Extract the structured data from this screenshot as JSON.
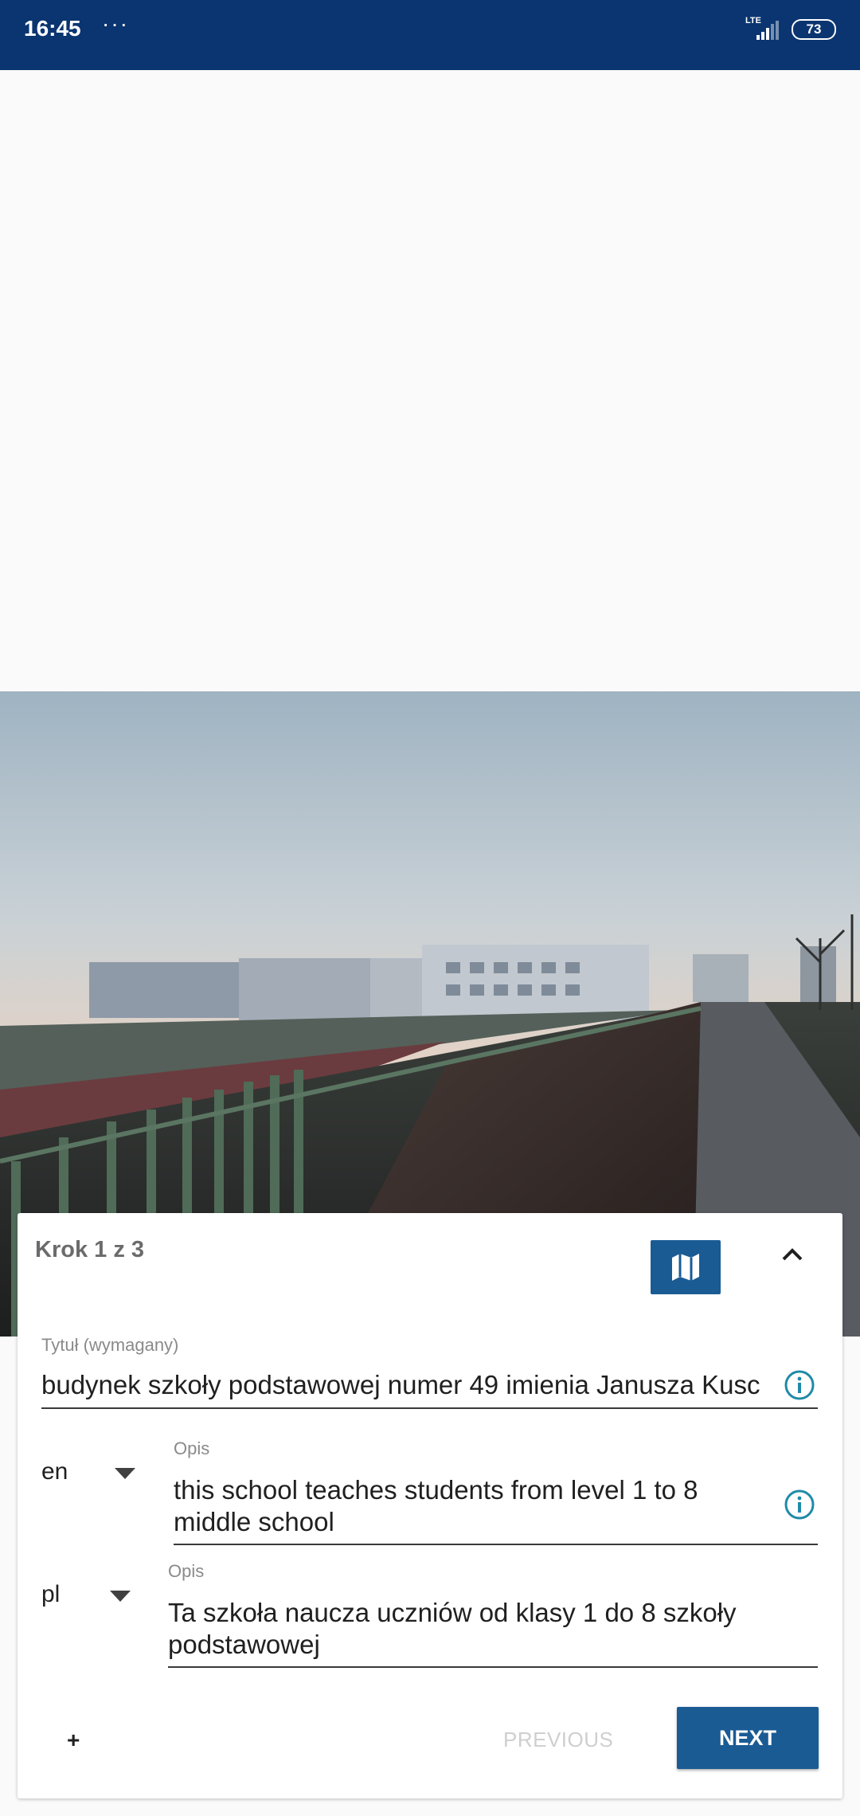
{
  "status_bar": {
    "time": "16:45",
    "overflow": "···",
    "network": "LTE",
    "battery": "73"
  },
  "wizard": {
    "step_label": "Krok 1 z 3",
    "title_field": {
      "label": "Tytuł (wymagany)",
      "value": "budynek szkoły podstawowej numer 49 imienia Janusza Kusc"
    },
    "descriptions": [
      {
        "language": "en",
        "label": "Opis",
        "value": "this school teaches students from level 1 to 8 middle school"
      },
      {
        "language": "pl",
        "label": "Opis",
        "value": "Ta szkoła naucza uczniów od klasy 1 do 8 szkoły podstawowej"
      }
    ],
    "add_label": "+",
    "previous_label": "PREVIOUS",
    "next_label": "NEXT"
  },
  "icons": [
    "map-icon",
    "chevron-up-icon",
    "info-icon",
    "dropdown-arrow-icon"
  ],
  "colors": {
    "status_bar": "#0a3570",
    "accent": "#1a5b94",
    "info": "#1f8aa8"
  }
}
